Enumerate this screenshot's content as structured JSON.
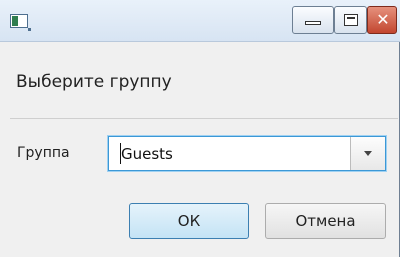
{
  "window": {
    "title": "",
    "controls": {
      "minimize_icon": "minimize-icon",
      "maximize_icon": "maximize-icon",
      "close_icon": "close-icon",
      "close_glyph": "✕"
    }
  },
  "dialog": {
    "heading": "Выберите группу",
    "group_label": "Группа",
    "group_value": "Guests",
    "ok_label": "ОК",
    "cancel_label": "Отмена"
  },
  "colors": {
    "focus_border": "#3c98d6",
    "close_button": "#c2462f",
    "default_button": "#c4e3f5"
  }
}
